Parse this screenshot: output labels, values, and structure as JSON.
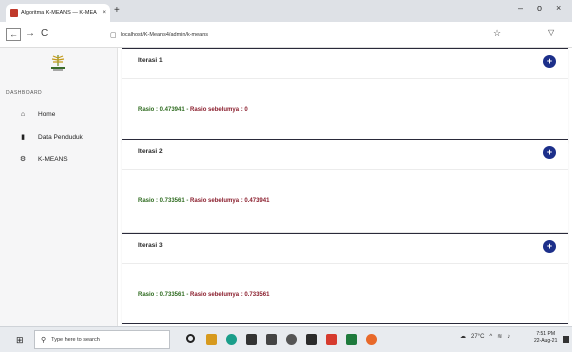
{
  "browser": {
    "tab_title": "Algoritma K-MEANS — K-MEA",
    "tab_close": "×",
    "new_tab": "+",
    "minimize": "–",
    "maximize": "o",
    "close": "×",
    "back": "←",
    "forward": "→",
    "reload": "C",
    "url": "localhost/K-Means4/admin/k-means"
  },
  "sidebar": {
    "section_label": "DASHBOARD",
    "items": [
      {
        "label": "Home",
        "icon": "home-icon",
        "glyph": "⌂"
      },
      {
        "label": "Data Penduduk",
        "icon": "file-icon",
        "glyph": "▮"
      },
      {
        "label": "K-MEANS",
        "icon": "cogs-icon",
        "glyph": "⚙"
      }
    ]
  },
  "main": {
    "cards": [
      {
        "title": "Iterasi 1",
        "ratio": "Rasio : 0.473941",
        "sep": " - ",
        "prev": "Rasio sebelumya : 0",
        "button": "+"
      },
      {
        "title": "Iterasi 2",
        "ratio": "Rasio : 0.733561",
        "sep": " - ",
        "prev": "Rasio sebelumya : 0.473941",
        "button": "+"
      },
      {
        "title": "Iterasi 3",
        "ratio": "Rasio : 0.733561",
        "sep": " - ",
        "prev": "Rasio sebelumya : 0.733561",
        "button": "+"
      }
    ]
  },
  "taskbar": {
    "search_placeholder": "Type here to search",
    "weather": "27°C",
    "time": "7:51 PM",
    "date": "22-Aug-21"
  },
  "colors": {
    "accent": "#1c2f8a",
    "ratio_current": "#2e6b1f",
    "ratio_previous": "#8a1d2c"
  }
}
